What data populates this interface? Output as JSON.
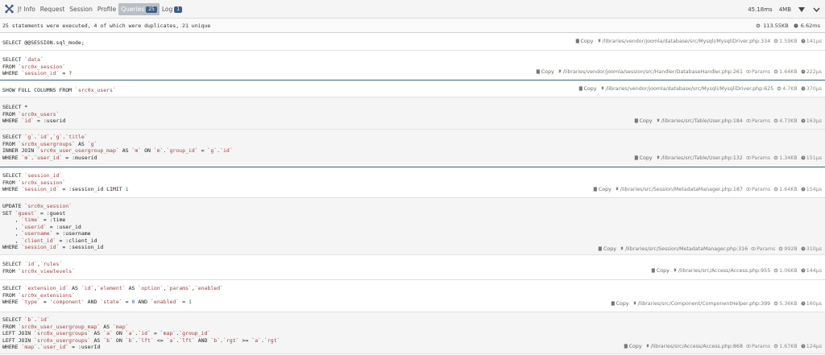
{
  "toolbar": {
    "tabs": [
      {
        "label": "J! Info"
      },
      {
        "label": "Request"
      },
      {
        "label": "Session"
      },
      {
        "label": "Profile"
      },
      {
        "label": "Queries",
        "badge": "25",
        "active": true
      },
      {
        "label": "Log",
        "badge": "1"
      }
    ],
    "time": "45.18ms",
    "memory": "4MB"
  },
  "summary": {
    "text": "25 statements were executed, 4 of which were duplicates, 21 unique",
    "total_memory": "113.55KB",
    "total_time": "6.62ms"
  },
  "queries": [
    {
      "sql": [
        "SELECT @@SESSION.sql_mode;"
      ],
      "copy": "Copy",
      "path": "/libraries/vendor/joomla/database/src/Mysqli/MysqliDriver.php:334",
      "params": "",
      "memory": "1.59KB",
      "time": "141μs"
    },
    {
      "sql": [
        "SELECT `data`",
        "FROM `src0x_session`",
        "WHERE `session_id` = ?"
      ],
      "copy": "Copy",
      "path": "/libraries/vendor/joomla/session/src/Handler/DatabaseHandler.php:261",
      "params": "Params",
      "memory": "1.64KB",
      "time": "222μs"
    },
    {
      "sql": [
        "SHOW FULL COLUMNS FROM `src0x_users`"
      ],
      "copy": "Copy",
      "path": "/libraries/vendor/joomla/database/src/Mysqli/MysqliDriver.php:625",
      "params": "",
      "memory": "4.7KB",
      "time": "370μs"
    },
    {
      "sql": [
        "SELECT *",
        "FROM `src0x_users`",
        "WHERE `id` = :userid"
      ],
      "copy": "Copy",
      "path": "/libraries/src/Table/User.php:184",
      "params": "Params",
      "memory": "4.73KB",
      "time": "163μs"
    },
    {
      "sql": [
        "SELECT `g`.`id`,`g`.`title`",
        "FROM `src0x_usergroups` AS `g`",
        "INNER JOIN `src0x_user_usergroup_map` AS `m` ON `m`.`group_id` = `g`.`id`",
        "WHERE `m`.`user_id` = :muserid"
      ],
      "copy": "Copy",
      "path": "/libraries/src/Table/User.php:132",
      "params": "Params",
      "memory": "1.34KB",
      "time": "151μs"
    },
    {
      "sql": [
        "SELECT `session_id`",
        "FROM `src0x_session`",
        "WHERE `session_id` = :session_id LIMIT 1"
      ],
      "copy": "Copy",
      "path": "/libraries/src/Session/MetadataManager.php:187",
      "params": "Params",
      "memory": "1.64KB",
      "time": "154μs"
    },
    {
      "sql": [
        "UPDATE `src0x_session`",
        "SET `guest` = :guest",
        "    , `time` = :time",
        "    , `userid` = :user_id",
        "    , `username` = :username",
        "    , `client_id` = :client_id",
        "WHERE `session_id` = :session_id"
      ],
      "copy": "Copy",
      "path": "/libraries/src/Session/MetadataManager.php:316",
      "params": "Params",
      "memory": "992B",
      "time": "310μs"
    },
    {
      "sql": [
        "SELECT `id`,`rules`",
        "FROM `src0x_viewlevels`"
      ],
      "copy": "Copy",
      "path": "/libraries/src/Access/Access.php:955",
      "params": "",
      "memory": "1.06KB",
      "time": "144μs"
    },
    {
      "sql": [
        "SELECT `extension_id` AS `id`,`element` AS `option`,`params`,`enabled`",
        "FROM `src0x_extensions`",
        "WHERE `type` = 'component' AND `state` = 0 AND `enabled` = 1"
      ],
      "copy": "Copy",
      "path": "/libraries/src/Component/ComponentHelper.php:399",
      "params": "",
      "memory": "5.36KB",
      "time": "160μs"
    },
    {
      "sql": [
        "SELECT `b`.`id`",
        "FROM `src0x_user_usergroup_map` AS `map`",
        "LEFT JOIN `src0x_usergroups` AS `a` ON `a`.`id` = `map`.`group_id`",
        "LEFT JOIN `src0x_usergroups` AS `b` ON `b`.`lft` <= `a`.`lft` AND `b`.`rgt` >= `a`.`rgt`",
        "WHERE `map`.`user_id` = :userId"
      ],
      "copy": "Copy",
      "path": "/libraries/src/Access/Access.php:868",
      "params": "Params",
      "memory": "1.67KB",
      "time": "124μs"
    }
  ]
}
